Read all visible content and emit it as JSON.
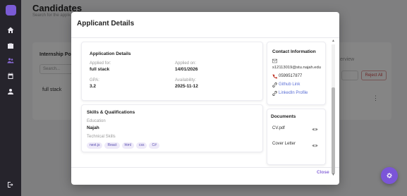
{
  "page": {
    "title": "Candidates",
    "subtitle": "Search for the applic",
    "left_card_title": "Internship Po",
    "search_placeholder": "Search...",
    "left_row_value": "full stack",
    "right_card_title": "erview",
    "reject_all": "Reject All",
    "more_menu": "⋮"
  },
  "modal": {
    "title": "Applicant Details",
    "close_label": "Close",
    "application": {
      "heading": "Application Details",
      "applied_for_label": "Applied for:",
      "applied_for_value": "full stack",
      "applied_on_label": "Applied on:",
      "applied_on_value": "14/01/2026",
      "gpa_label": "GPA:",
      "gpa_value": "3.2",
      "availability_label": "Availability:",
      "availability_value": "2025-11-12"
    },
    "skills": {
      "heading": "Skills & Qualifications",
      "education_label": "Education",
      "education_value": "Najah",
      "technical_label": "Technical Skills",
      "chips": [
        "next.js",
        "React",
        "html",
        "css",
        "C#"
      ]
    },
    "contact": {
      "heading": "Contact Information",
      "email": "s12113019@stu.najah.edu",
      "phone": "0599517877",
      "github_label": "Github Link",
      "linkedin_label": "LinkedIn Profile"
    },
    "documents": {
      "heading": "Documents",
      "items": [
        "CV.pdf",
        "Cover Letter"
      ]
    }
  },
  "colors": {
    "sidebar": "#26242c",
    "accent": "#7b55d8",
    "link": "#5b6fd6",
    "reject": "#d04848"
  }
}
